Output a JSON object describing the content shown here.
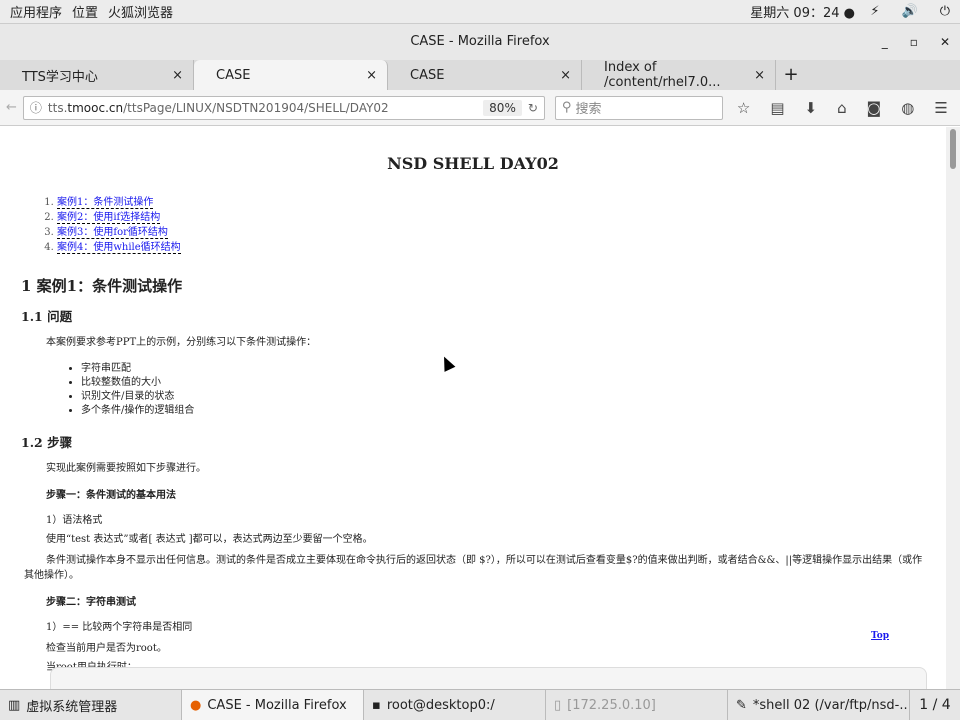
{
  "topbar": {
    "apps": "应用程序",
    "places": "位置",
    "browser": "火狐浏览器",
    "clock": "星期六 09：24 ●"
  },
  "window": {
    "title": "CASE - Mozilla Firefox"
  },
  "tabs": [
    {
      "label": "TTS学习中心"
    },
    {
      "label": "CASE"
    },
    {
      "label": "CASE"
    },
    {
      "label": "Index of /content/rhel7.0..."
    }
  ],
  "nav": {
    "url_prefix": "tts.",
    "url_domain": "tmooc.cn",
    "url_path": "/ttsPage/LINUX/NSDTN201904/SHELL/DAY02",
    "zoom": "80%",
    "search_placeholder": "搜索"
  },
  "page": {
    "title": "NSD SHELL DAY02",
    "toc": [
      "案例1：条件测试操作",
      "案例2：使用if选择结构",
      "案例3：使用for循环结构",
      "案例4：使用while循环结构"
    ],
    "h_case1": "1 案例1：条件测试操作",
    "h_problem": "1.1 问题",
    "problem_text": "本案例要求参考PPT上的示例，分别练习以下条件测试操作：",
    "bullets": [
      "字符串匹配",
      "比较整数值的大小",
      "识别文件/目录的状态",
      "多个条件/操作的逻辑组合"
    ],
    "h_steps": "1.2 步骤",
    "steps_intro": "实现此案例需要按照如下步骤进行。",
    "step1": "步骤一：条件测试的基本用法",
    "syntax": "1）语法格式",
    "syntax_text": "使用“test 表达式”或者[ 表达式 ]都可以，表达式两边至少要留一个空格。",
    "para": "条件测试操作本身不显示出任何信息。测试的条件是否成立主要体现在命令执行后的返回状态（即 $?），所以可以在测试后查看变量$?的值来做出判断，或者结合&&、||等逻辑操作显示出结果（或作其他操作）。",
    "step2": "步骤二：字符串测试",
    "cmp": "1）== 比较两个字符串是否相同",
    "check": "检查当前用户是否为root。",
    "when": "当root用户执行时：",
    "top_link": "Top"
  },
  "taskbar": [
    {
      "label": "虚拟系统管理器"
    },
    {
      "label": "CASE - Mozilla Firefox"
    },
    {
      "label": "root@desktop0:/"
    },
    {
      "label": "[172.25.0.10]"
    },
    {
      "label": "*shell 02 (/var/ftp/nsd-..."
    }
  ],
  "pager": "1 / 4"
}
